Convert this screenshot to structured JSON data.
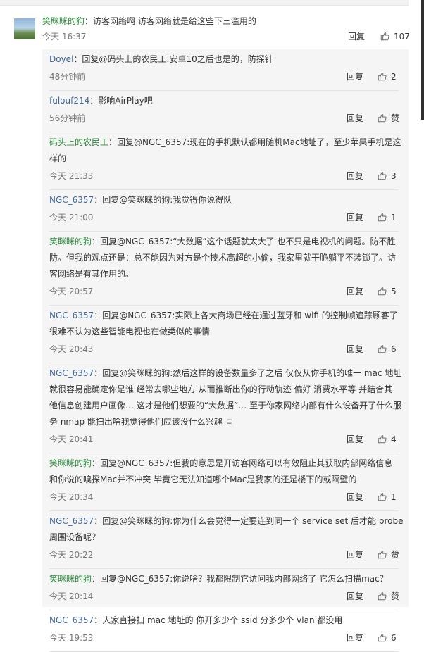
{
  "main_comment": {
    "user": "笑眯眯的狗",
    "text": "：访客网络啊 访客网络就是给这些下三滥用的",
    "time": "今天 16:37",
    "reply_label": "回复",
    "likes": "107"
  },
  "replies": [
    {
      "user": "Doyel",
      "lines": [
        "：回复@码头上的农民工:安卓10之后也是的，防探针"
      ],
      "time": "48分钟前",
      "reply_label": "回复",
      "likes": "2"
    },
    {
      "user": "fulouf214",
      "lines": [
        "：影响AirPlay吧"
      ],
      "time": "56分钟前",
      "reply_label": "回复",
      "likes": "赞"
    },
    {
      "user": "码头上的农民工",
      "lines": [
        "：回复@NGC_6357:现在的手机默认都用随机Mac地址了，至少苹果手机是这",
        "样的"
      ],
      "time": "今天 21:33",
      "reply_label": "回复",
      "likes": "3"
    },
    {
      "user": "NGC_6357",
      "lines": [
        "：回复@笑眯眯的狗:我觉得你说得队"
      ],
      "time": "今天 21:00",
      "reply_label": "回复",
      "likes": "1"
    },
    {
      "user": "笑眯眯的狗",
      "lines": [
        "：回复@NGC_6357:“大数据”这个话题就太大了 也不只是电视机的问题。防不胜",
        "防。但我的观点还是：总不能因为对方是个技术高超的小偷，我家里就干脆躺平不装锁了。访",
        "客网络是有其作用的。"
      ],
      "time": "今天 20:57",
      "reply_label": "回复",
      "likes": "5"
    },
    {
      "user": "NGC_6357",
      "lines": [
        "：回复@NGC_6357:实际上各大商场已经在通过蓝牙和 wifi 的控制帧追踪顾客了",
        "很难不认为这些智能电视也在做类似的事情"
      ],
      "time": "今天 20:43",
      "reply_label": "回复",
      "likes": "6"
    },
    {
      "user": "NGC_6357",
      "lines": [
        "：回复@笑眯眯的狗:然后这样的设备数量多了之后 仅仅从你手机的唯一 mac 地址",
        "就很容易能确定你是谁 经常去哪些地方 从而推断出你的行动轨迹 偏好 消费水平等 并结合其",
        "他信息创建用户画像… 这才是他们想要的“大数据”… 至于你家网络内部有什么设备开了什么服",
        "务 nmap 能扫出啥我觉得他们应该没什么兴趣 ㄷ"
      ],
      "time": "今天 20:41",
      "reply_label": "回复",
      "likes": "4"
    },
    {
      "user": "笑眯眯的狗",
      "lines": [
        "：回复@NGC_6357:但我的意思是开访客网络可以有效阻止其获取内部网络信息",
        "和你说的嗅探Mac并不冲突 毕竟它无法知道哪个Mac是我家的还是楼下的或隔壁的"
      ],
      "time": "今天 20:34",
      "reply_label": "回复",
      "likes": "1"
    },
    {
      "user": "NGC_6357",
      "lines": [
        "：回复@笑眯眯的狗:你为什么会觉得一定要连到同一个 service set 后才能 probe",
        "周围设备呢？"
      ],
      "time": "今天 20:22",
      "reply_label": "回复",
      "likes": "赞"
    },
    {
      "user": "笑眯眯的狗",
      "lines": [
        "：回复@NGC_6357:你说啥？我都限制它访问我内部网络了 它怎么扫描mac？"
      ],
      "time": "今天 20:14",
      "reply_label": "回复",
      "likes": "赞"
    },
    {
      "user": "NGC_6357",
      "lines": [
        "：人家直接扫 mac 地址的 你开多少个 ssid 分多少个 vlan 都没用"
      ],
      "time": "今天 19:53",
      "reply_label": "回复",
      "likes": "6"
    }
  ],
  "colors": {
    "user_green": "#2c8a3b",
    "user_blue": "#406599",
    "panel_bg": "#f5f5f5"
  },
  "icons": {
    "like": "thumbs-up-icon"
  }
}
